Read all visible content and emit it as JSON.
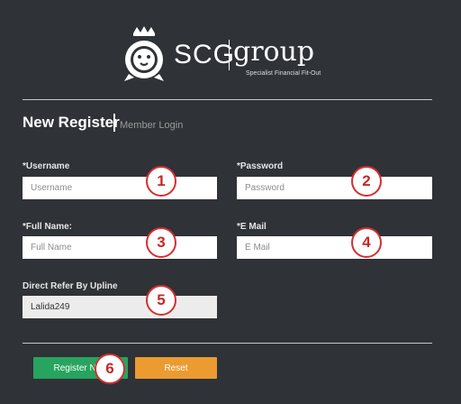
{
  "brand": {
    "name": "SCG",
    "group": "group",
    "tagline": "Specialist Financial Fit-Out"
  },
  "header": {
    "title": "New Register",
    "member_login": "Member Login"
  },
  "form": {
    "username": {
      "label": "*Username",
      "placeholder": "Username"
    },
    "password": {
      "label": "*Password",
      "placeholder": "Password"
    },
    "full_name": {
      "label": "*Full Name:",
      "placeholder": "Full Name"
    },
    "email": {
      "label": "*E Mail",
      "placeholder": "E Mail"
    },
    "upline": {
      "label": "Direct Refer By Upline",
      "value": "Lalida249"
    }
  },
  "buttons": {
    "register": "Register Now",
    "reset": "Reset"
  },
  "badges": [
    "1",
    "2",
    "3",
    "4",
    "5",
    "6"
  ],
  "colors": {
    "background": "#2f3237",
    "register_button": "#27a45f",
    "reset_button": "#eb9b30",
    "badge_border": "#d32f2f"
  }
}
